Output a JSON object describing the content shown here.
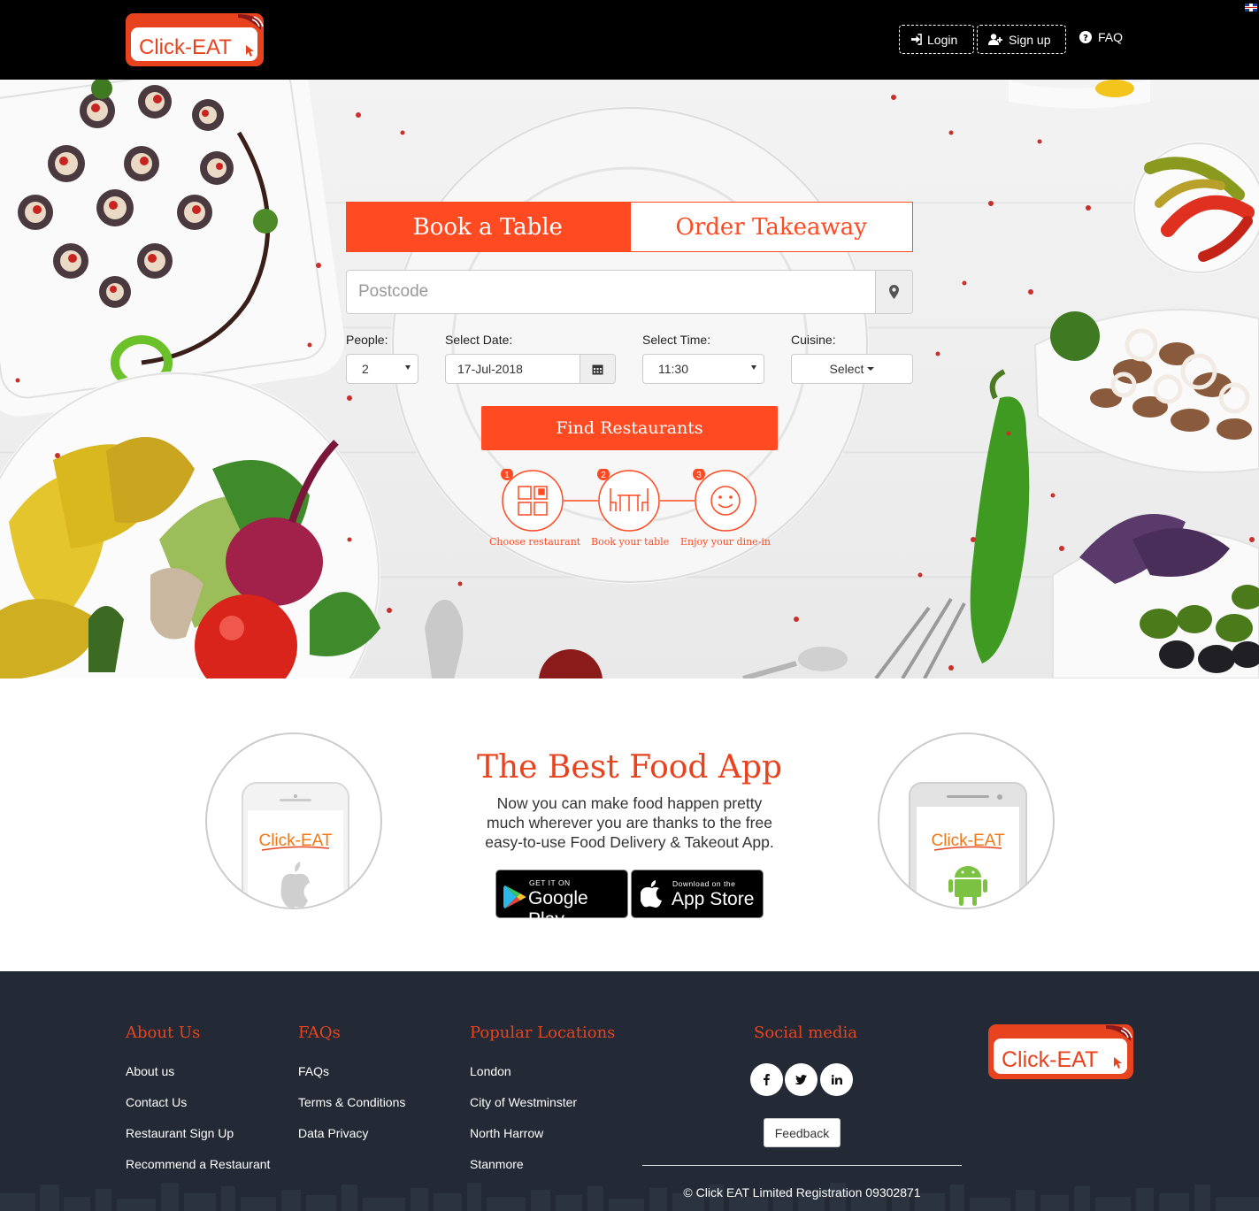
{
  "brand": {
    "name": "Click-EAT",
    "accent": "#ff4a22",
    "dark": "#232a35",
    "logo_red": "#e8431f"
  },
  "header": {
    "login_label": "Login",
    "signup_label": "Sign up",
    "faq_label": "FAQ",
    "icons": {
      "login": "sign-in-icon",
      "signup": "user-plus-icon",
      "faq": "question-circle-icon",
      "language": "uk-flag-icon"
    }
  },
  "booking": {
    "tabs": [
      {
        "label": "Book a Table",
        "active": true
      },
      {
        "label": "Order Takeaway",
        "active": false
      }
    ],
    "postcode": {
      "placeholder": "Postcode",
      "value": ""
    },
    "people": {
      "label": "People:",
      "value": "2"
    },
    "date": {
      "label": "Select Date:",
      "value": "17-Jul-2018"
    },
    "time": {
      "label": "Select Time:",
      "value": "11:30"
    },
    "cuisine": {
      "label": "Cuisine:",
      "value": "Select"
    },
    "find_label": "Find Restaurants",
    "steps": [
      {
        "num": "1",
        "label": "Choose restaurant",
        "icon": "grid-icon"
      },
      {
        "num": "2",
        "label": "Book your table",
        "icon": "table-chairs-icon"
      },
      {
        "num": "3",
        "label": "Enjoy your dine-in",
        "icon": "smiley-icon"
      }
    ]
  },
  "app": {
    "title": "The Best Food App",
    "text": "Now you can make food happen pretty much wherever you are thanks to the free easy-to-use Food Delivery & Takeout App.",
    "google": {
      "small": "GET IT ON",
      "big": "Google Play"
    },
    "apple": {
      "small": "Download on the",
      "big": "App Store"
    },
    "phone_logo": "Click-EAT"
  },
  "footer": {
    "about": {
      "title": "About Us",
      "links": [
        "About us",
        "Contact Us",
        "Restaurant Sign Up",
        "Recommend a Restaurant"
      ]
    },
    "faqs": {
      "title": "FAQs",
      "links": [
        "FAQs",
        "Terms & Conditions",
        "Data Privacy"
      ]
    },
    "locations": {
      "title": "Popular Locations",
      "links": [
        "London",
        "City of Westminster",
        "North Harrow",
        "Stanmore"
      ]
    },
    "social": {
      "title": "Social media",
      "icons": [
        "facebook-icon",
        "twitter-icon",
        "linkedin-icon"
      ]
    },
    "feedback_label": "Feedback",
    "copyright": "© Click EAT Limited Registration 09302871"
  }
}
